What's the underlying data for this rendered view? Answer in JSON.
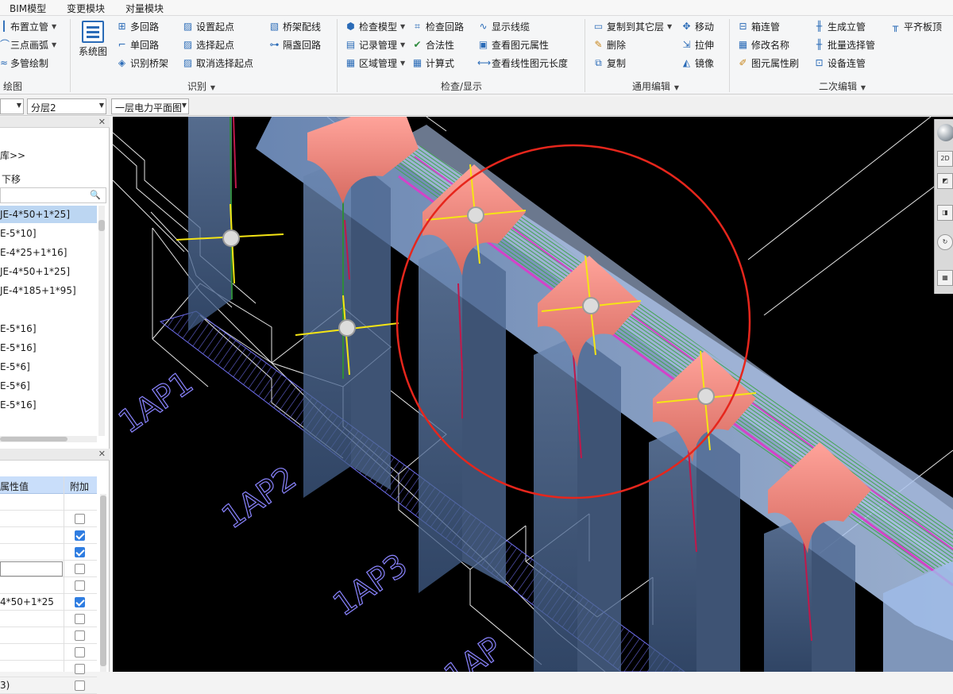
{
  "menu": {
    "tabs": [
      "BIM模型",
      "变更模块",
      "对量模块"
    ]
  },
  "ribbon": {
    "draw": {
      "items": [
        {
          "label": "布置立管",
          "icon": "vertical-pipe-icon"
        },
        {
          "label": "三点画弧",
          "icon": "three-point-arc-icon"
        },
        {
          "label": "多管绘制",
          "icon": "multi-pipe-draw-icon"
        }
      ],
      "group_label": "绘图"
    },
    "identify": {
      "system_diagram": "系统图",
      "col1": [
        "多回路",
        "单回路",
        "识别桥架"
      ],
      "col2": [
        "设置起点",
        "选择起点",
        "取消选择起点"
      ],
      "col3": [
        "桥架配线",
        "隔盏回路"
      ],
      "group_label": "识别"
    },
    "check": {
      "col1": [
        "检查模型",
        "记录管理",
        "区域管理"
      ],
      "col2": [
        "检查回路",
        "合法性",
        "计算式"
      ],
      "col3": [
        "显示线缆",
        "查看图元属性",
        "查看线性图元长度"
      ],
      "group_label": "检查/显示"
    },
    "edit": {
      "col1": [
        "复制到其它层",
        "删除",
        "复制"
      ],
      "col2": [
        "移动",
        "拉伸",
        "镜像"
      ],
      "group_label": "通用编辑"
    },
    "secondary": {
      "col1": [
        "箱连管",
        "修改名称",
        "图元属性刷"
      ],
      "col2": [
        "生成立管",
        "批量选择管",
        "设备连管"
      ],
      "col3": [
        "平齐板顶"
      ],
      "group_label": "二次编辑"
    }
  },
  "toolbar2": {
    "layer": "分层2",
    "drawing": "一层电力平面图"
  },
  "left_panel": {
    "library_link": "库>>",
    "move_down": "下移",
    "search_placeholder": "",
    "items": [
      "JE-4*50+1*25]",
      "E-5*10]",
      "E-4*25+1*16]",
      "JE-4*50+1*25]",
      "JE-4*185+1*95]",
      "",
      "E-5*16]",
      "E-5*16]",
      "E-5*6]",
      "E-5*6]",
      "E-5*16]"
    ],
    "prop_header": {
      "value": "属性值",
      "extra": "附加"
    },
    "props": [
      {
        "value": "",
        "checked": null
      },
      {
        "value": "",
        "checked": false
      },
      {
        "value": "",
        "checked": true
      },
      {
        "value": "",
        "checked": true
      },
      {
        "value": "",
        "checked": false,
        "editing": true
      },
      {
        "value": "",
        "checked": false
      },
      {
        "value": "4*50+1*25",
        "checked": true
      },
      {
        "value": "",
        "checked": false
      },
      {
        "value": "",
        "checked": false
      },
      {
        "value": "",
        "checked": false
      },
      {
        "value": "",
        "checked": false
      },
      {
        "value": "3)",
        "checked": false
      }
    ]
  },
  "viewport": {
    "labels": [
      "1AP1",
      "1AP2",
      "1AP3",
      "1AP"
    ],
    "colors": {
      "background": "#000000",
      "tray": "#8fb0e0",
      "fitting": "#f08a80",
      "column": "#5e7aa2",
      "cable": "#3da34a",
      "highlight": "#e6261c",
      "snap": "#f5e514"
    }
  }
}
